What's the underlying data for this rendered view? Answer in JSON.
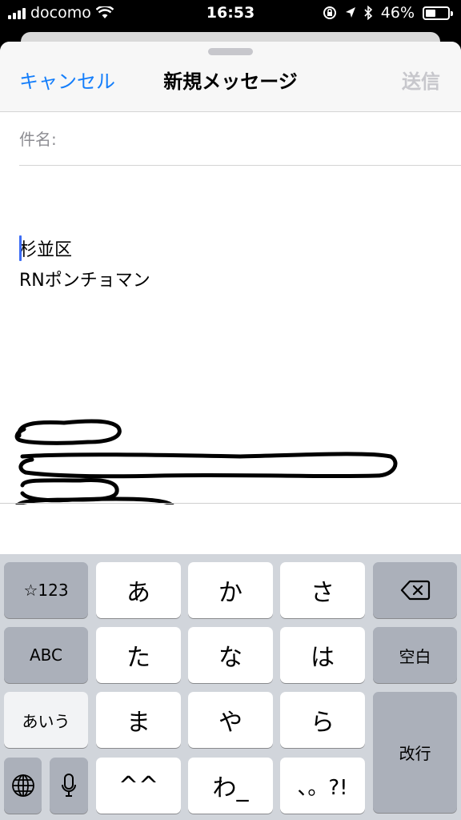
{
  "status_bar": {
    "carrier": "docomo",
    "time": "16:53",
    "battery_percent_label": "46%",
    "battery_level": 0.46
  },
  "compose": {
    "cancel_label": "キャンセル",
    "title": "新規メッセージ",
    "send_label": "送信",
    "subject_label": "件名:",
    "body_lines": [
      "杉並区",
      "RNポンチョマン"
    ]
  },
  "keyboard": {
    "row1": {
      "mode_label": "☆123",
      "keys": [
        "あ",
        "か",
        "さ"
      ]
    },
    "row2": {
      "mode_label": "ABC",
      "keys": [
        "た",
        "な",
        "は"
      ],
      "space_label": "空白"
    },
    "row3": {
      "mode_label": "あいう",
      "keys": [
        "ま",
        "や",
        "ら"
      ]
    },
    "row4": {
      "keys": [
        "^^",
        "わ_",
        "、。?!"
      ]
    },
    "return_label": "改行"
  },
  "colors": {
    "accent": "#147efb",
    "disabled": "#c7c7cc",
    "keyboard_bg": "#d1d5db"
  }
}
